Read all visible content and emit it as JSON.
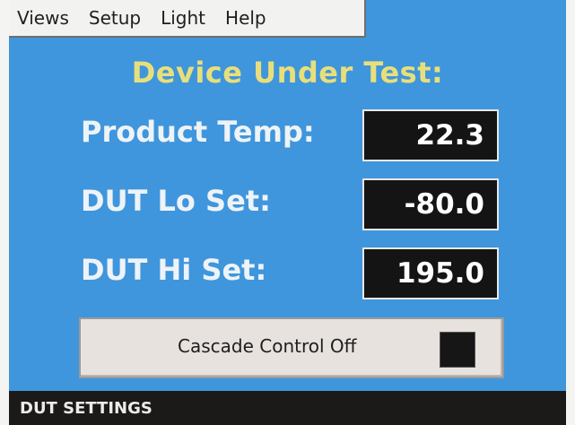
{
  "menu": {
    "items": [
      {
        "label": "Views"
      },
      {
        "label": "Setup"
      },
      {
        "label": "Light"
      },
      {
        "label": "Help"
      }
    ]
  },
  "title": "Device Under Test:",
  "rows": [
    {
      "label": "Product Temp:",
      "value": "22.3"
    },
    {
      "label": "DUT Lo Set:",
      "value": "-80.0"
    },
    {
      "label": "DUT Hi Set:",
      "value": "195.0"
    }
  ],
  "cascade": {
    "label": "Cascade Control Off",
    "indicator_color": "#161616"
  },
  "status": {
    "text": "DUT SETTINGS"
  },
  "colors": {
    "background": "#3f96dc",
    "title": "#e8df7a",
    "label": "#eef3f7",
    "value_box": "#141414",
    "status_bar": "#1b1a19"
  }
}
